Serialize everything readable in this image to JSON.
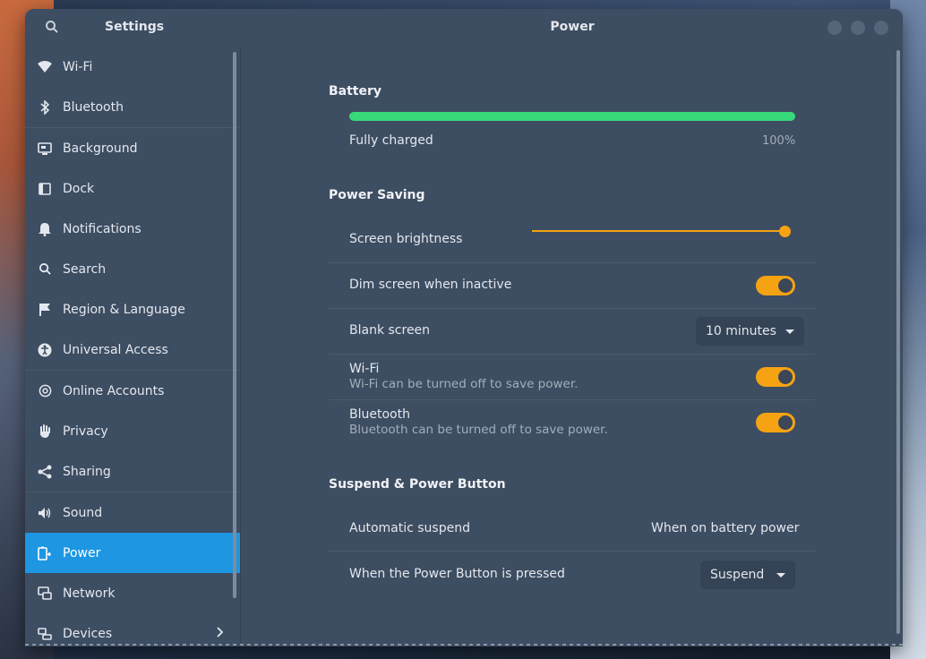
{
  "window": {
    "sidebar_title": "Settings",
    "title": "Power"
  },
  "sidebar": {
    "items": [
      {
        "label": "Wi-Fi",
        "icon": "wifi-icon"
      },
      {
        "label": "Bluetooth",
        "icon": "bluetooth-icon"
      },
      {
        "label": "Background",
        "icon": "background-icon"
      },
      {
        "label": "Dock",
        "icon": "dock-icon"
      },
      {
        "label": "Notifications",
        "icon": "bell-icon"
      },
      {
        "label": "Search",
        "icon": "search-icon"
      },
      {
        "label": "Region & Language",
        "icon": "flag-icon"
      },
      {
        "label": "Universal Access",
        "icon": "accessibility-icon"
      },
      {
        "label": "Online Accounts",
        "icon": "at-icon"
      },
      {
        "label": "Privacy",
        "icon": "hand-icon"
      },
      {
        "label": "Sharing",
        "icon": "share-icon"
      },
      {
        "label": "Sound",
        "icon": "speaker-icon"
      },
      {
        "label": "Power",
        "icon": "power-icon",
        "active": true
      },
      {
        "label": "Network",
        "icon": "network-icon"
      },
      {
        "label": "Devices",
        "icon": "devices-icon"
      }
    ]
  },
  "battery": {
    "section_title": "Battery",
    "status": "Fully charged",
    "percent": "100%",
    "level": 1.0
  },
  "power_saving": {
    "section_title": "Power Saving",
    "brightness_label": "Screen brightness",
    "brightness_level": 1.0,
    "dim_label": "Dim screen when inactive",
    "blank_label": "Blank screen",
    "blank_value": "10 minutes",
    "wifi_label": "Wi-Fi",
    "wifi_sub": "Wi-Fi can be turned off to save power.",
    "bt_label": "Bluetooth",
    "bt_sub": "Bluetooth can be turned off to save power."
  },
  "suspend": {
    "section_title": "Suspend & Power Button",
    "auto_label": "Automatic suspend",
    "auto_value": "When on battery power",
    "button_label": "When the Power Button is pressed",
    "button_value": "Suspend"
  },
  "colors": {
    "accent": "#f5a312",
    "selection": "#1e96e2",
    "battery": "#38d97a"
  }
}
